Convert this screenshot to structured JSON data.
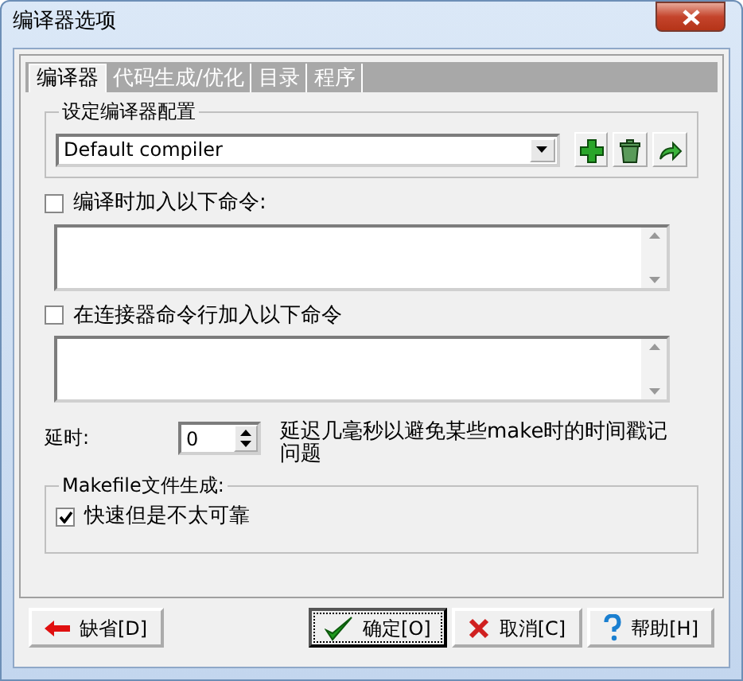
{
  "window": {
    "title": "编译器选项"
  },
  "tabs": [
    {
      "label": "编译器",
      "selected": true
    },
    {
      "label": "代码生成/优化",
      "selected": false
    },
    {
      "label": "目录",
      "selected": false
    },
    {
      "label": "程序",
      "selected": false
    }
  ],
  "compiler_set": {
    "label": "设定编译器配置",
    "value": "Default compiler"
  },
  "command_options": [
    {
      "label": "编译时加入以下命令:",
      "checked": false
    },
    {
      "label": "在连接器命令行加入以下命令",
      "checked": false
    }
  ],
  "delay": {
    "label": "延时:",
    "value": "0",
    "note": "延迟几毫秒以避免某些make时的时间戳记问题"
  },
  "makefile": {
    "label": "Makefile文件生成:",
    "options": [
      {
        "label": "快速但是不太可靠",
        "checked": true
      }
    ]
  },
  "buttons": [
    {
      "label": "缺省[D]",
      "kind": "default"
    },
    {
      "label": "确定[O]",
      "kind": "ok"
    },
    {
      "label": "取消[C]",
      "kind": "cancel"
    },
    {
      "label": "帮助[H]",
      "kind": "help"
    }
  ]
}
